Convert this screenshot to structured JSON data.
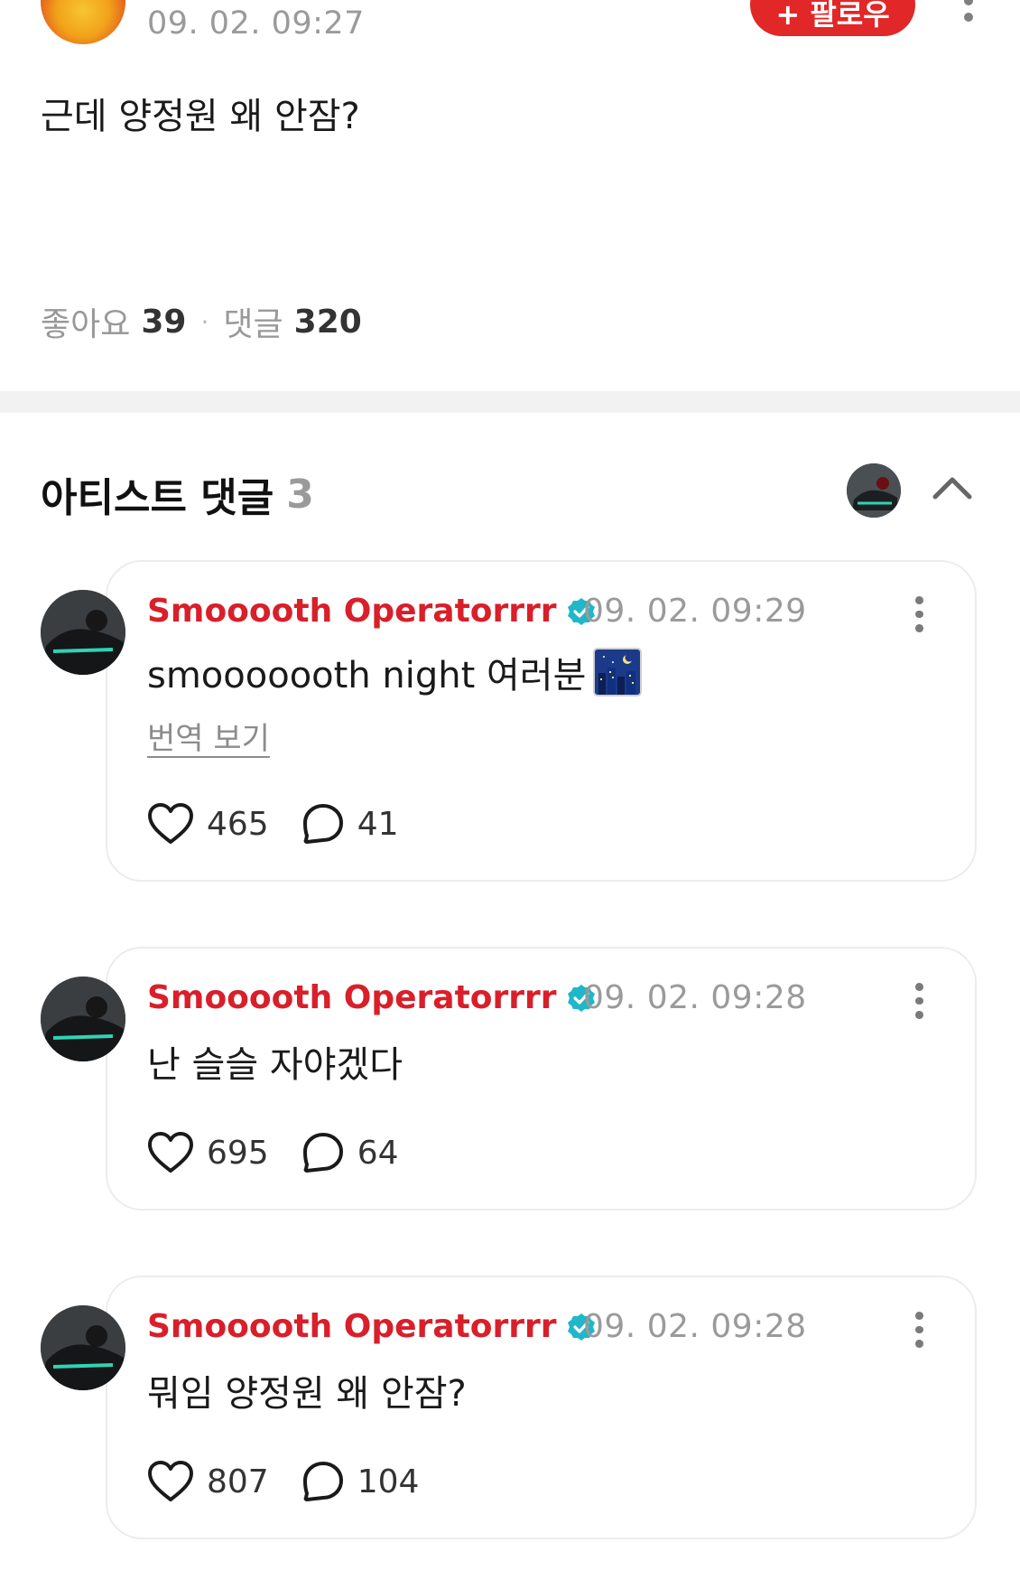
{
  "post": {
    "time": "09. 02. 09:27",
    "follow_label": "+ 팔로우",
    "text": "근데 양정원 왜 안잠?",
    "likes_label": "좋아요",
    "likes": "39",
    "comments_label": "댓글",
    "comments": "320"
  },
  "section": {
    "title": "아티스트 댓글",
    "count": "3"
  },
  "comments": [
    {
      "name": "Smooooth Operatorrrr",
      "time": "09. 02. 09:29",
      "text": "smooooooth night 여러분",
      "emoji": "night-city-icon",
      "translate": "번역 보기",
      "likes": "465",
      "replies": "41"
    },
    {
      "name": "Smooooth Operatorrrr",
      "time": "09. 02. 09:28",
      "text": "난 슬슬 자야겠다",
      "likes": "695",
      "replies": "64"
    },
    {
      "name": "Smooooth Operatorrrr",
      "time": "09. 02. 09:28",
      "text": "뭐임 양정원 왜 안잠?",
      "likes": "807",
      "replies": "104"
    }
  ],
  "colors": {
    "accent": "#e12727",
    "name": "#d81f2a",
    "verified": "#1fb7c9"
  }
}
